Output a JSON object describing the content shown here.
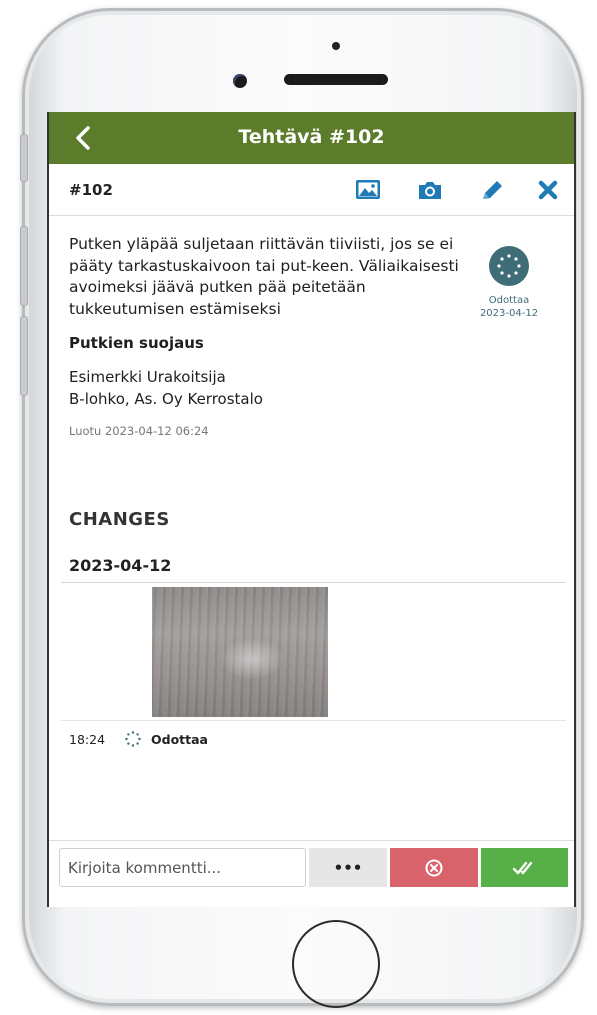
{
  "header": {
    "title": "Tehtävä #102"
  },
  "toolbar": {
    "task_id": "#102"
  },
  "task": {
    "description": "Putken yläpää suljetaan riittävän tiiviisti, jos se ei pääty tarkastuskaivoon tai put-keen. Väliaikaisesti avoimeksi jäävä putken pää peitetään tukkeutumisen estämiseksi",
    "status_label": "Odottaa",
    "status_date": "2023-04-12",
    "section_title": "Putkien suojaus",
    "contractor": "Esimerkki Urakoitsija",
    "location": "B-lohko, As. Oy Kerrostalo",
    "created": "Luotu 2023-04-12 06:24"
  },
  "changes": {
    "heading": "CHANGES",
    "groups": [
      {
        "date": "2023-04-12",
        "entries": [
          {
            "time": "18:24",
            "status": "Odottaa"
          }
        ]
      }
    ]
  },
  "comment_bar": {
    "placeholder": "Kirjoita kommentti...",
    "more_label": "•••"
  },
  "icons": {
    "back": "chevron-left-icon",
    "gallery": "image-icon",
    "camera": "camera-icon",
    "edit": "pencil-icon",
    "close": "close-icon",
    "status": "pending-spinner-icon",
    "reject": "circle-x-icon",
    "approve": "double-check-icon"
  },
  "colors": {
    "header_bg": "#5b7c2b",
    "accent_blue": "#1f7ab5",
    "status_badge": "#3e6c77",
    "reject": "#d9636a",
    "approve": "#57b047"
  }
}
